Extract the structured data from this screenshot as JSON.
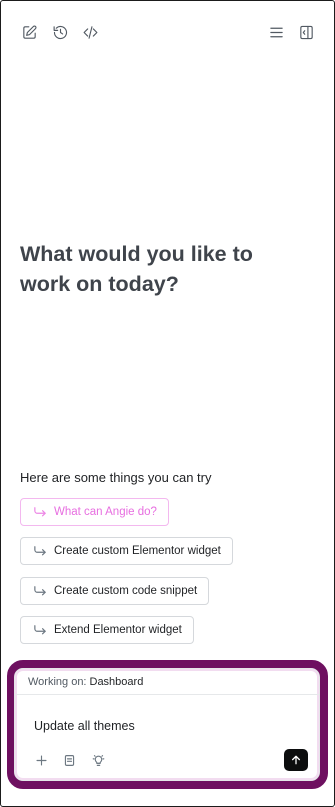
{
  "toolbar": {
    "left_icons": [
      "new-chat-icon",
      "history-icon",
      "code-icon"
    ],
    "right_icons": [
      "menu-icon",
      "collapse-panel-icon"
    ]
  },
  "main": {
    "headline": "What would you like to work on today?",
    "suggestions_title": "Here are some things you can try",
    "suggestions": [
      {
        "label": "What can Angie do?",
        "active": true
      },
      {
        "label": "Create custom Elementor widget",
        "active": false
      },
      {
        "label": "Create custom code snippet",
        "active": false
      },
      {
        "label": "Extend Elementor widget",
        "active": false
      }
    ]
  },
  "composer": {
    "working_on_label": "Working on:",
    "working_on_value": "Dashboard",
    "prompt_value": "Update all themes",
    "actions": [
      "plus-icon",
      "document-icon",
      "lightbulb-icon"
    ],
    "send_icon": "arrow-up-icon"
  },
  "colors": {
    "accent_pink": "#e76ee0",
    "highlight_frame": "#6e1060",
    "headline": "#3f444b"
  }
}
